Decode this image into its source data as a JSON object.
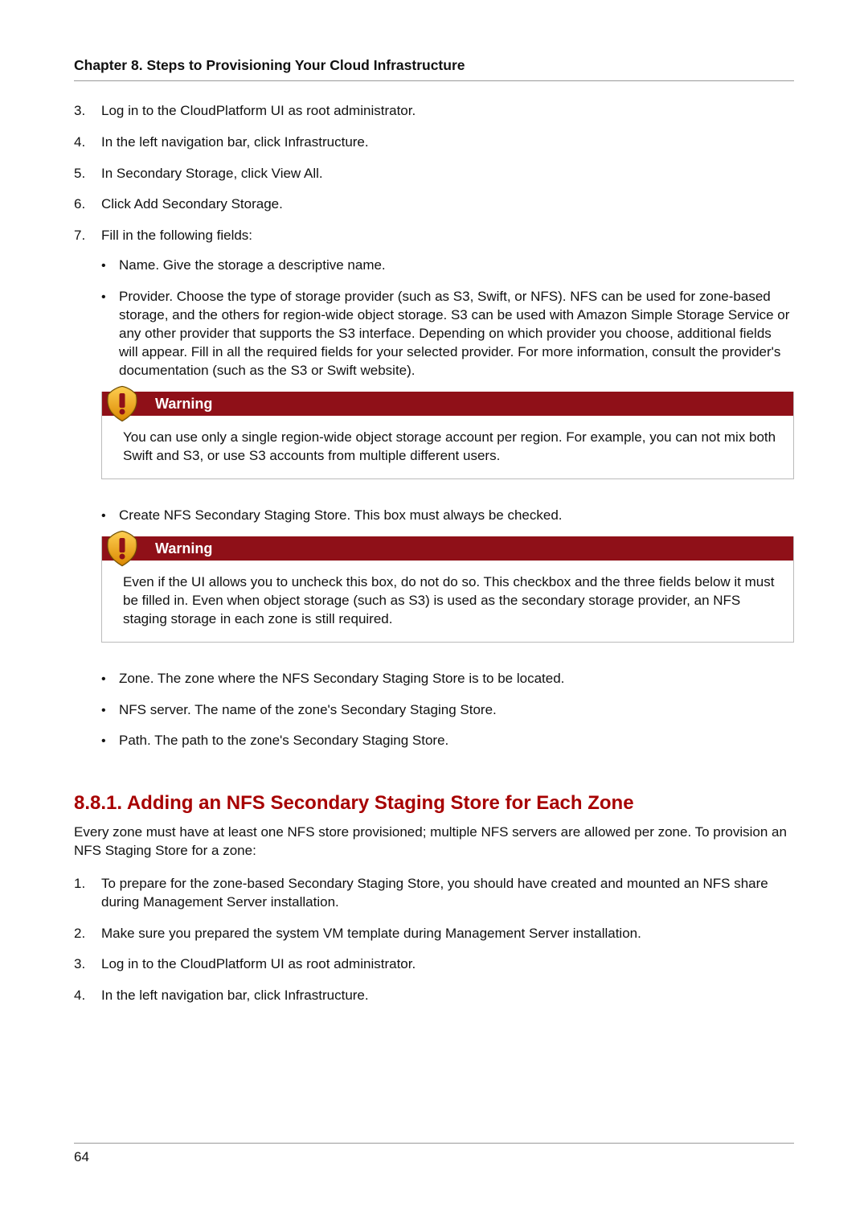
{
  "chapter_header": "Chapter 8. Steps to Provisioning Your Cloud Infrastructure",
  "steps": {
    "s3": {
      "num": "3.",
      "text": "Log in to the CloudPlatform UI as root administrator."
    },
    "s4": {
      "num": "4.",
      "text": "In the left navigation bar, click Infrastructure."
    },
    "s5": {
      "num": "5.",
      "text": "In Secondary Storage, click View All."
    },
    "s6": {
      "num": "6.",
      "text": "Click Add Secondary Storage."
    },
    "s7": {
      "num": "7.",
      "text": "Fill in the following fields:"
    }
  },
  "bullets_top": {
    "name": "Name. Give the storage a descriptive name.",
    "provider": "Provider. Choose the type of storage provider (such as S3, Swift, or NFS). NFS can be used for zone-based storage, and the others for region-wide object storage. S3 can be used with Amazon Simple Storage Service or any other provider that supports the S3 interface. Depending on which provider you choose, additional fields will appear. Fill in all the required fields for your selected provider. For more information, consult the provider's documentation (such as the S3 or Swift website).",
    "create_staging": "Create NFS Secondary Staging Store. This box must always be checked.",
    "zone": "Zone. The zone where the NFS Secondary Staging Store is to be located.",
    "nfs_server": "NFS server. The name of the zone's Secondary Staging Store.",
    "path": "Path. The path to the zone's Secondary Staging Store."
  },
  "warnings": {
    "label": "Warning",
    "w1": "You can use only a single region-wide object storage account per region. For example, you can not mix both Swift and S3, or use S3 accounts from multiple different users.",
    "w2": "Even if the UI allows you to uncheck this box, do not do so. This checkbox and the three fields below it must be filled in. Even when object storage (such as S3) is used as the secondary storage provider, an NFS staging storage in each zone is still required."
  },
  "section": {
    "title": "8.8.1. Adding an NFS Secondary Staging Store for Each Zone",
    "intro": "Every zone must have at least one NFS store provisioned; multiple NFS servers are allowed per zone. To provision an NFS Staging Store for a zone:",
    "steps": {
      "s1": {
        "num": "1.",
        "text": "To prepare for the zone-based Secondary Staging Store, you should have created and mounted an NFS share during Management Server installation."
      },
      "s2": {
        "num": "2.",
        "text": "Make sure you prepared the system VM template during Management Server installation."
      },
      "s3": {
        "num": "3.",
        "text": "Log in to the CloudPlatform UI as root administrator."
      },
      "s4": {
        "num": "4.",
        "text": "In the left navigation bar, click Infrastructure."
      }
    }
  },
  "page_number": "64"
}
